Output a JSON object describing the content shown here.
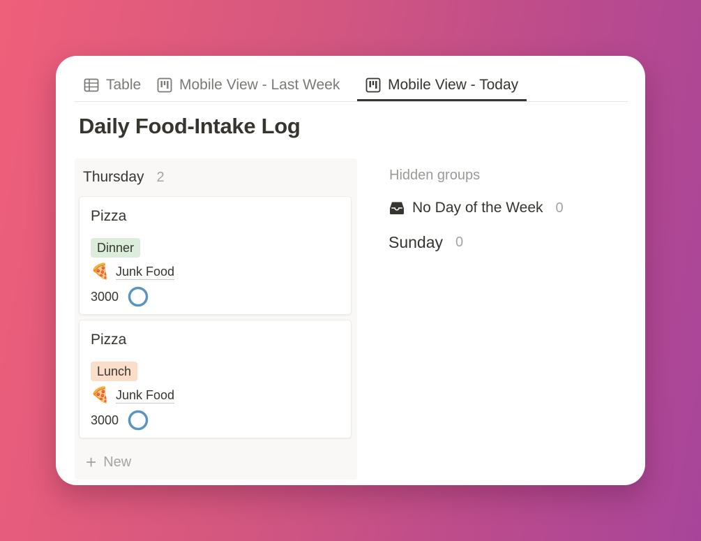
{
  "tabs": [
    {
      "label": "Table",
      "icon": "table-icon",
      "active": false
    },
    {
      "label": "Mobile View - Last Week",
      "icon": "board-icon",
      "active": false
    },
    {
      "label": "Mobile View - Today",
      "icon": "board-icon",
      "active": true
    }
  ],
  "page": {
    "title": "Daily Food-Intake Log"
  },
  "board": {
    "group": {
      "name": "Thursday",
      "count": "2"
    },
    "cards": [
      {
        "title": "Pizza",
        "meal": "Dinner",
        "relation_emoji": "🍕",
        "relation": "Junk Food",
        "calories": "3000"
      },
      {
        "title": "Pizza",
        "meal": "Lunch",
        "relation_emoji": "🍕",
        "relation": "Junk Food",
        "calories": "3000"
      }
    ],
    "new_label": "New"
  },
  "hidden_groups": {
    "label": "Hidden groups",
    "items": [
      {
        "name": "No Day of the Week",
        "count": "0",
        "icon": "inbox-icon"
      },
      {
        "name": "Sunday",
        "count": "0"
      }
    ]
  },
  "colors": {
    "dinner_tag": "#dbeddb",
    "lunch_tag": "#fadec9",
    "progress_ring": "#5b94bd",
    "text": "#37352f",
    "muted": "#a5a4a0"
  }
}
